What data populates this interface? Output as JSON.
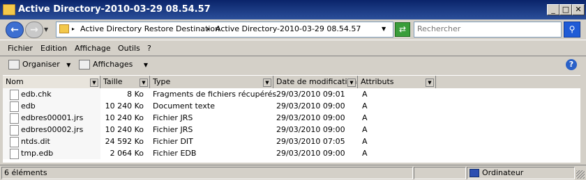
{
  "window": {
    "title": "Active Directory-2010-03-29 08.54.57",
    "controls": {
      "minimize": "_",
      "maximize": "□",
      "close": "✕"
    }
  },
  "address": {
    "crumbs": [
      "Active Directory Restore Destination",
      "Active Directory-2010-03-29 08.54.57"
    ],
    "search_placeholder": "Rechercher"
  },
  "menu": [
    "Fichier",
    "Edition",
    "Affichage",
    "Outils",
    "?"
  ],
  "toolbar": {
    "organize_label": "Organiser",
    "views_label": "Affichages",
    "help_label": "?"
  },
  "columns": [
    "Nom",
    "Taille",
    "Type",
    "Date de modification",
    "Attributs"
  ],
  "files": [
    {
      "name": "edb.chk",
      "size": "8 Ko",
      "type": "Fragments de fichiers récupérés",
      "date": "29/03/2010 09:01",
      "attr": "A"
    },
    {
      "name": "edb",
      "size": "10 240 Ko",
      "type": "Document texte",
      "date": "29/03/2010 09:00",
      "attr": "A"
    },
    {
      "name": "edbres00001.jrs",
      "size": "10 240 Ko",
      "type": "Fichier JRS",
      "date": "29/03/2010 09:00",
      "attr": "A"
    },
    {
      "name": "edbres00002.jrs",
      "size": "10 240 Ko",
      "type": "Fichier JRS",
      "date": "29/03/2010 09:00",
      "attr": "A"
    },
    {
      "name": "ntds.dit",
      "size": "24 592 Ko",
      "type": "Fichier DIT",
      "date": "29/03/2010 07:05",
      "attr": "A"
    },
    {
      "name": "tmp.edb",
      "size": "2 064 Ko",
      "type": "Fichier EDB",
      "date": "29/03/2010 09:00",
      "attr": "A"
    }
  ],
  "status": {
    "count": "6 éléments",
    "location": "Ordinateur"
  },
  "colors": {
    "titlebar": "#0a246a",
    "chrome": "#d4d0c8"
  }
}
